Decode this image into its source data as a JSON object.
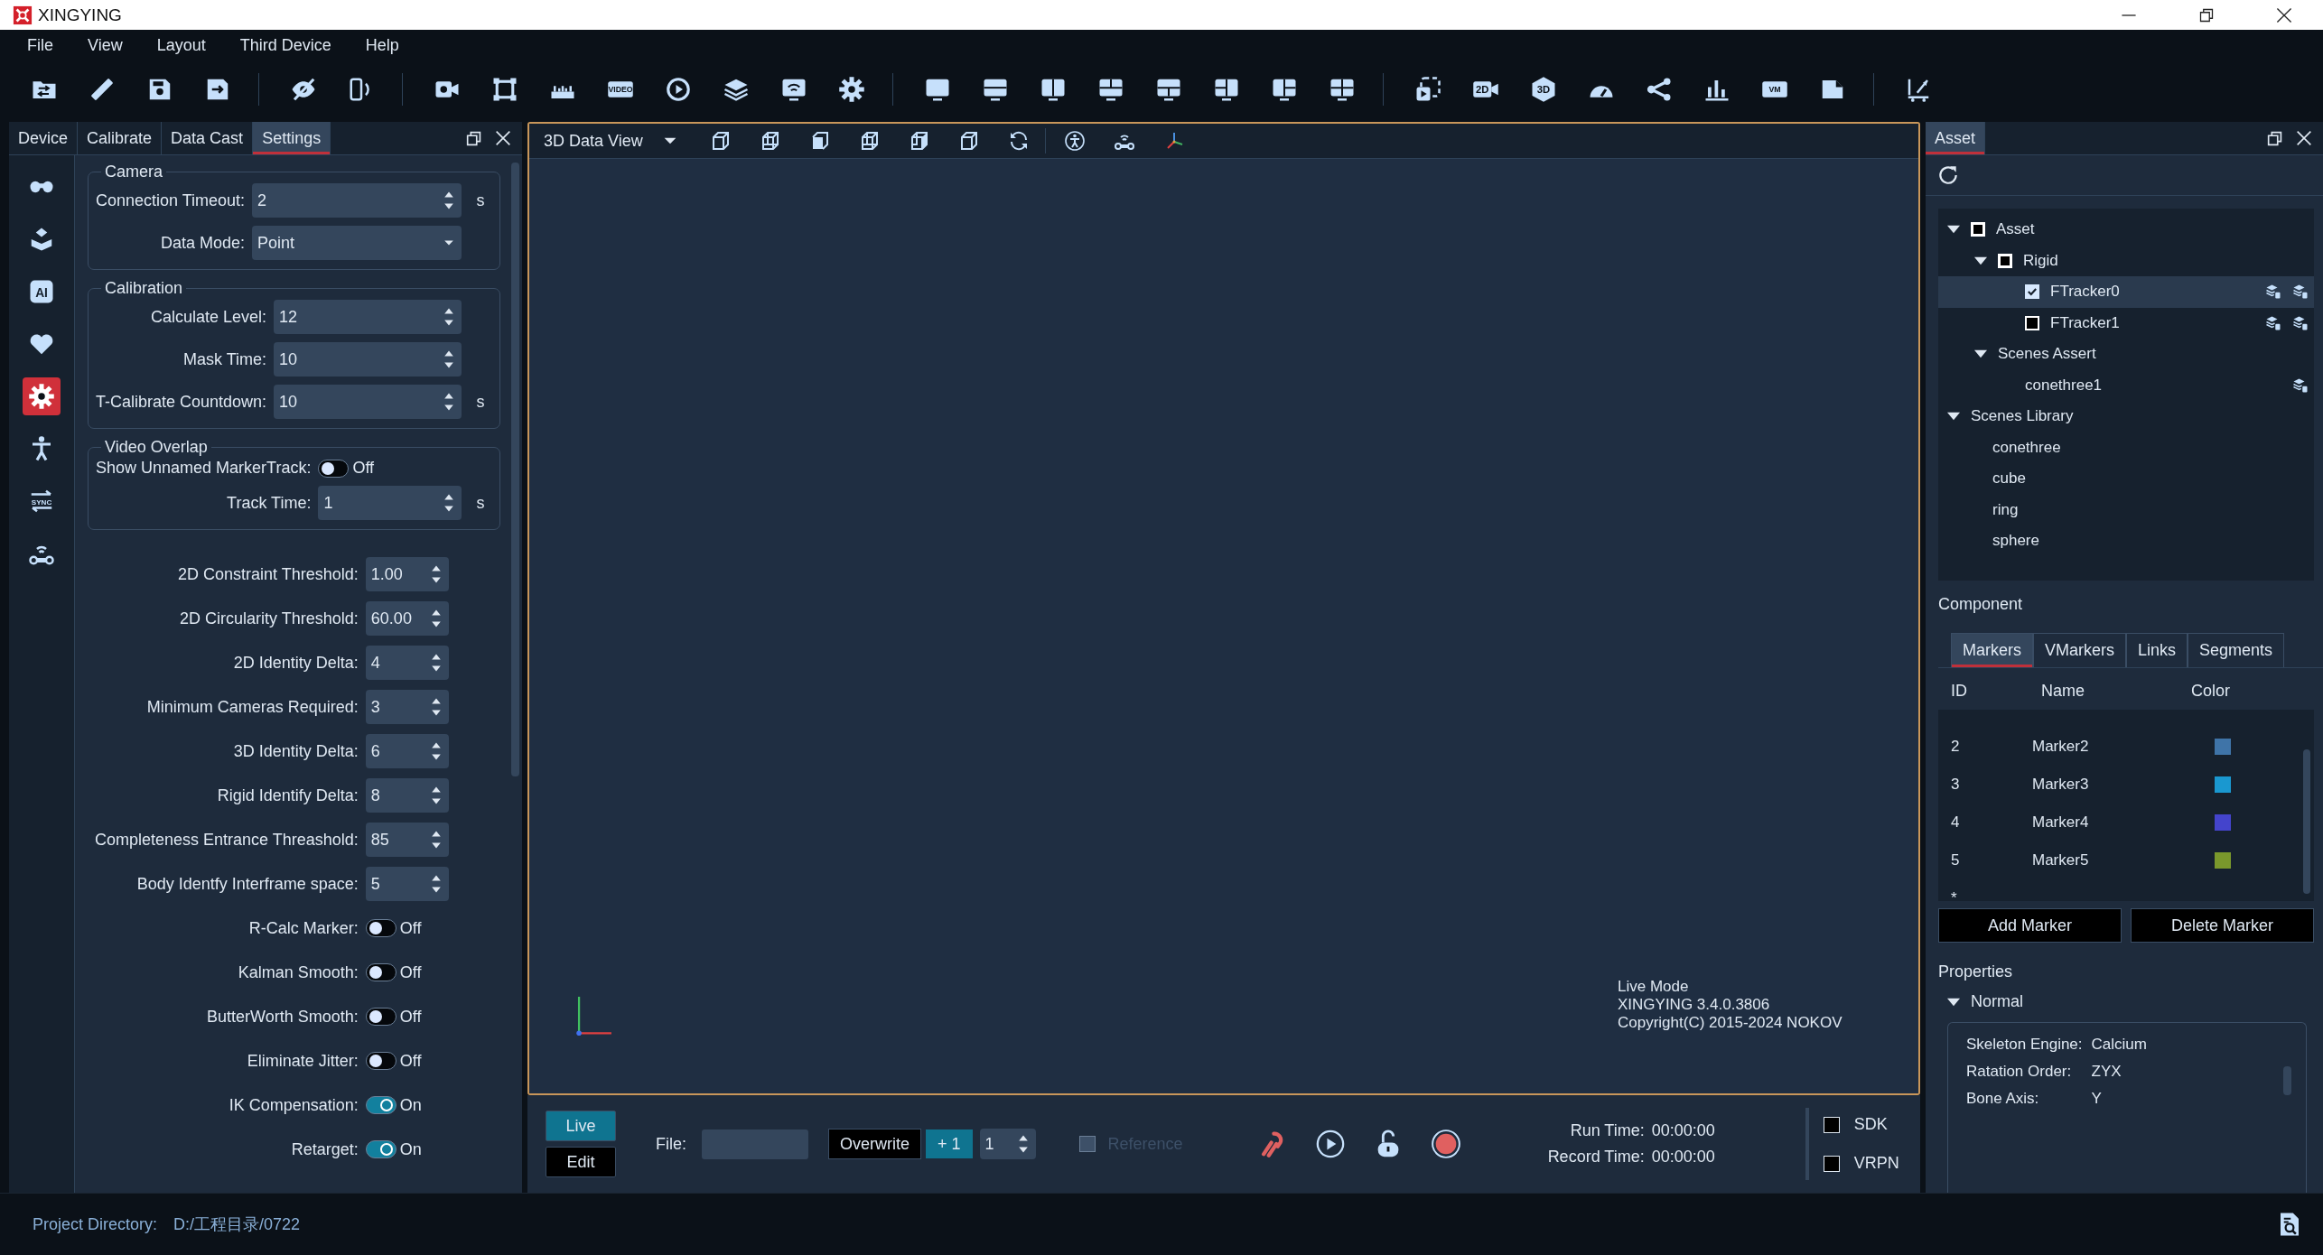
{
  "window": {
    "title": "XINGYING"
  },
  "menu": [
    "File",
    "View",
    "Layout",
    "Third Device",
    "Help"
  ],
  "toolbar": {
    "groups": [
      [
        {
          "kind": "folder"
        },
        {
          "kind": "ruler"
        },
        {
          "kind": "save"
        },
        {
          "kind": "save-arrow"
        }
      ],
      [
        {
          "kind": "eye-off"
        },
        {
          "kind": "phone-rotate"
        }
      ],
      [
        {
          "kind": "camera"
        },
        {
          "kind": "frame"
        },
        {
          "kind": "ruler-bar"
        },
        {
          "kind": "label",
          "text": "VIDEO"
        },
        {
          "kind": "replay"
        },
        {
          "kind": "layers"
        },
        {
          "kind": "monitor-wifi"
        },
        {
          "kind": "gear"
        }
      ],
      [
        {
          "kind": "monitor"
        },
        {
          "kind": "monitor-rows"
        },
        {
          "kind": "monitor-cols"
        },
        {
          "kind": "monitor-top"
        },
        {
          "kind": "monitor-bottom"
        },
        {
          "kind": "monitor-left"
        },
        {
          "kind": "monitor-right"
        },
        {
          "kind": "monitor-grid"
        }
      ],
      [
        {
          "kind": "frame-play"
        },
        {
          "kind": "camera-label",
          "text": "2D"
        },
        {
          "kind": "hexagon",
          "text": "3D"
        },
        {
          "kind": "gauge"
        },
        {
          "kind": "share"
        },
        {
          "kind": "bars"
        },
        {
          "kind": "label",
          "text": "VM"
        },
        {
          "kind": "file"
        }
      ],
      [
        {
          "kind": "scale"
        }
      ]
    ]
  },
  "left_panel": {
    "tabs": [
      {
        "label": "Device",
        "selected": false
      },
      {
        "label": "Calibrate",
        "selected": false
      },
      {
        "label": "Data Cast",
        "selected": false
      },
      {
        "label": "Settings",
        "selected": true
      }
    ],
    "sidebar": [
      {
        "kind": "dots",
        "selected": false
      },
      {
        "kind": "arm",
        "selected": false
      },
      {
        "kind": "badge",
        "text": "AI",
        "selected": false
      },
      {
        "kind": "heart",
        "selected": false
      },
      {
        "kind": "gear",
        "selected": true
      },
      {
        "kind": "person",
        "selected": false
      },
      {
        "kind": "sync",
        "text": "SYNC",
        "selected": false
      },
      {
        "kind": "wifi-robot",
        "selected": false
      }
    ],
    "groups": [
      {
        "title": "Camera",
        "fields": [
          {
            "kind": "spin",
            "label": "Connection Timeout:",
            "value": "2",
            "unit": "s"
          },
          {
            "kind": "dropdown",
            "label": "Data Mode:",
            "value": "Point"
          }
        ]
      },
      {
        "title": "Calibration",
        "fields": [
          {
            "kind": "spin",
            "label": "Calculate Level:",
            "value": "12"
          },
          {
            "kind": "spin",
            "label": "Mask Time:",
            "value": "10"
          },
          {
            "kind": "spin",
            "label": "T-Calibrate Countdown:",
            "value": "10",
            "unit": "s"
          }
        ]
      },
      {
        "title": "Video Overlap",
        "fields": [
          {
            "kind": "toggle",
            "label": "Show Unnamed MarkerTrack:",
            "on": false,
            "state": "Off"
          },
          {
            "kind": "spin",
            "label": "Track Time:",
            "value": "1",
            "unit": "s"
          }
        ]
      }
    ],
    "settings": [
      {
        "kind": "spin",
        "label": "2D Constraint Threshold:",
        "value": "1.00"
      },
      {
        "kind": "spin",
        "label": "2D Circularity Threshold:",
        "value": "60.00"
      },
      {
        "kind": "spin",
        "label": "2D Identity Delta:",
        "value": "4"
      },
      {
        "kind": "spin",
        "label": "Minimum Cameras Required:",
        "value": "3"
      },
      {
        "kind": "spin",
        "label": "3D Identity Delta:",
        "value": "6"
      },
      {
        "kind": "spin",
        "label": "Rigid Identify Delta:",
        "value": "8"
      },
      {
        "kind": "spin",
        "label": "Completeness Entrance Threashold:",
        "value": "85"
      },
      {
        "kind": "spin",
        "label": "Body Identfy Interframe space:",
        "value": "5"
      },
      {
        "kind": "toggle",
        "label": "R-Calc Marker:",
        "on": false,
        "state": "Off"
      },
      {
        "kind": "toggle",
        "label": "Kalman Smooth:",
        "on": false,
        "state": "Off"
      },
      {
        "kind": "toggle",
        "label": "ButterWorth Smooth:",
        "on": false,
        "state": "Off"
      },
      {
        "kind": "toggle",
        "label": "Eliminate Jitter:",
        "on": false,
        "state": "Off"
      },
      {
        "kind": "toggle",
        "label": "IK Compensation:",
        "on": true,
        "state": "On"
      },
      {
        "kind": "toggle",
        "label": "Retarget:",
        "on": true,
        "state": "On"
      }
    ]
  },
  "view": {
    "title": "3D Data View",
    "tools": [
      {
        "kind": "cube"
      },
      {
        "kind": "cube-wire"
      },
      {
        "kind": "cube-solid"
      },
      {
        "kind": "cube-wire"
      },
      {
        "kind": "cube-half"
      },
      {
        "kind": "cube"
      },
      {
        "kind": "refresh"
      },
      {
        "kind": "person-rotate"
      },
      {
        "kind": "wifi-robot"
      },
      {
        "kind": "axes"
      }
    ],
    "info": [
      "Live Mode",
      "XINGYING 3.4.0.3806",
      "Copyright(C) 2015-2024 NOKOV"
    ]
  },
  "controls": {
    "modes": [
      {
        "label": "Live",
        "selected": true
      },
      {
        "label": "Edit",
        "selected": false
      }
    ],
    "file_label": "File:",
    "overwrite": "Overwrite",
    "step": "+ 1",
    "count": "1",
    "reference": {
      "label": "Reference",
      "checked": false,
      "disabled": true
    },
    "actions": [
      {
        "kind": "chain"
      },
      {
        "kind": "play"
      },
      {
        "kind": "unlock"
      },
      {
        "kind": "record"
      }
    ],
    "times": [
      {
        "label": "Run Time:",
        "value": "00:00:00"
      },
      {
        "label": "Record Time:",
        "value": "00:00:00"
      }
    ],
    "outputs": [
      {
        "label": "SDK",
        "checked": false
      },
      {
        "label": "VRPN",
        "checked": false
      }
    ]
  },
  "right_panel": {
    "tab": "Asset",
    "tree": [
      {
        "kind": "group",
        "label": "Asset",
        "expanded": true,
        "checked": false,
        "partial": true,
        "selected": false,
        "children": [
          {
            "kind": "group",
            "label": "Rigid",
            "expanded": true,
            "checked": false,
            "partial": true,
            "selected": false,
            "children": [
              {
                "kind": "tracker",
                "label": "FTracker0",
                "checked": true,
                "selected": true
              },
              {
                "kind": "tracker",
                "label": "FTracker1",
                "checked": false,
                "selected": false
              }
            ]
          },
          {
            "kind": "group",
            "label": "Scenes Assert",
            "expanded": true,
            "selected": false,
            "children": [
              {
                "kind": "scene",
                "label": "conethree1",
                "selected": false
              }
            ]
          }
        ]
      },
      {
        "kind": "group",
        "label": "Scenes Library",
        "expanded": true,
        "selected": false,
        "children": [
          {
            "kind": "item",
            "label": "conethree",
            "selected": false
          },
          {
            "kind": "item",
            "label": "cube",
            "selected": false
          },
          {
            "kind": "item",
            "label": "ring",
            "selected": false
          },
          {
            "kind": "item",
            "label": "sphere",
            "selected": false
          }
        ]
      }
    ],
    "component_title": "Component",
    "component_tabs": [
      {
        "label": "Markers",
        "selected": true
      },
      {
        "label": "VMarkers",
        "selected": false
      },
      {
        "label": "Links",
        "selected": false
      },
      {
        "label": "Segments",
        "selected": false
      }
    ],
    "columns": [
      "ID",
      "Name",
      "Color"
    ],
    "markers": [
      {
        "id": "2",
        "name": "Marker2",
        "color": "#3f74a8"
      },
      {
        "id": "3",
        "name": "Marker3",
        "color": "#1a98d0"
      },
      {
        "id": "4",
        "name": "Marker4",
        "color": "#4444cc"
      },
      {
        "id": "5",
        "name": "Marker5",
        "color": "#7a982c"
      }
    ],
    "new_row": "*",
    "buttons": [
      "Add Marker",
      "Delete Marker"
    ],
    "properties_title": "Properties",
    "section": {
      "label": "Normal",
      "expanded": true
    },
    "properties": [
      {
        "label": "Skeleton Engine:",
        "value": "Calcium"
      },
      {
        "label": "Ratation Order:",
        "value": "ZYX"
      },
      {
        "label": "Bone Axis:",
        "value": "Y"
      }
    ]
  },
  "status_bar": {
    "label": "Project Directory:",
    "path": "D:/工程目录/0722"
  }
}
